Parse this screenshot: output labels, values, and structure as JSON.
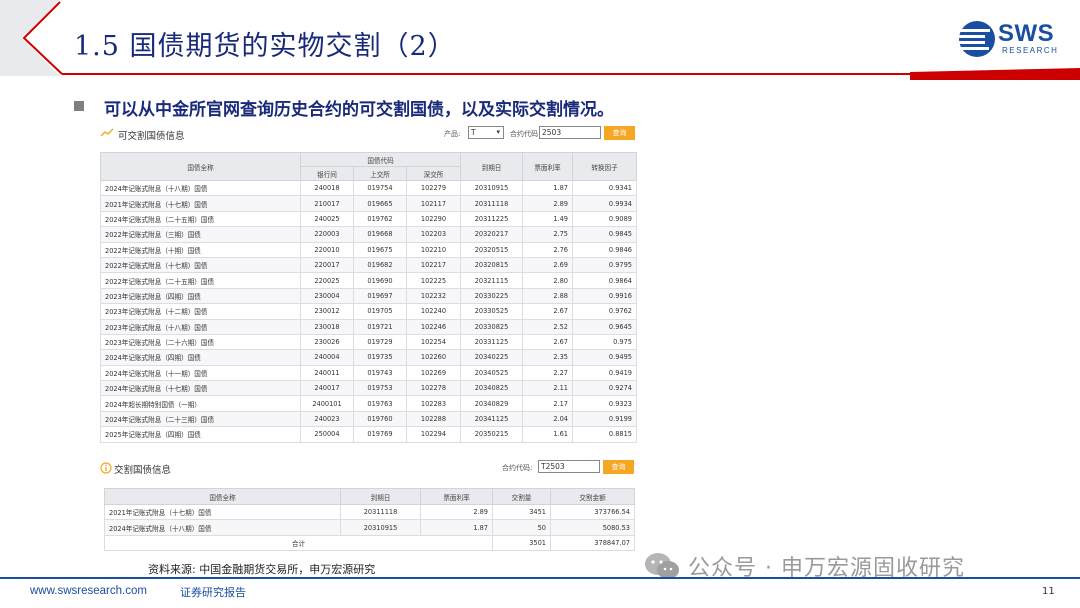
{
  "header": {
    "title": "1.5 国债期货的实物交割（2）",
    "logo_text": "SWS",
    "logo_sub": "RESEARCH",
    "colors": {
      "red": "#cc0000",
      "navy": "#1a2a7a",
      "blue": "#1a4ea0"
    }
  },
  "subtitle": "可以从中金所官网查询历史合约的可交割国债，以及实际交割情况。",
  "deliverable": {
    "title": "可交割国债信息",
    "product_label": "产品:",
    "product_value": "T",
    "contract_label": "合约代码",
    "contract_value": "2503",
    "query_label": "查询",
    "columns": {
      "name": "国债全称",
      "code_group": "国债代码",
      "interbank": "银行间",
      "sse": "上交所",
      "szse": "深交所",
      "maturity": "到期日",
      "coupon": "票面利率",
      "factor": "转换因子"
    },
    "rows": [
      [
        "2024年记账式附息（十八期）国债",
        "240018",
        "019754",
        "102279",
        "20310915",
        "1.87",
        "0.9341"
      ],
      [
        "2021年记账式附息（十七期）国债",
        "210017",
        "019665",
        "102117",
        "20311118",
        "2.89",
        "0.9934"
      ],
      [
        "2024年记账式附息（二十五期）国债",
        "240025",
        "019762",
        "102290",
        "20311225",
        "1.49",
        "0.9089"
      ],
      [
        "2022年记账式附息（三期）国债",
        "220003",
        "019668",
        "102203",
        "20320217",
        "2.75",
        "0.9845"
      ],
      [
        "2022年记账式附息（十期）国债",
        "220010",
        "019675",
        "102210",
        "20320515",
        "2.76",
        "0.9846"
      ],
      [
        "2022年记账式附息（十七期）国债",
        "220017",
        "019682",
        "102217",
        "20320815",
        "2.69",
        "0.9795"
      ],
      [
        "2022年记账式附息（二十五期）国债",
        "220025",
        "019690",
        "102225",
        "20321115",
        "2.80",
        "0.9864"
      ],
      [
        "2023年记账式附息（四期）国债",
        "230004",
        "019697",
        "102232",
        "20330225",
        "2.88",
        "0.9916"
      ],
      [
        "2023年记账式附息（十二期）国债",
        "230012",
        "019705",
        "102240",
        "20330525",
        "2.67",
        "0.9762"
      ],
      [
        "2023年记账式附息（十八期）国债",
        "230018",
        "019721",
        "102246",
        "20330825",
        "2.52",
        "0.9645"
      ],
      [
        "2023年记账式附息（二十六期）国债",
        "230026",
        "019729",
        "102254",
        "20331125",
        "2.67",
        "0.975"
      ],
      [
        "2024年记账式附息（四期）国债",
        "240004",
        "019735",
        "102260",
        "20340225",
        "2.35",
        "0.9495"
      ],
      [
        "2024年记账式附息（十一期）国债",
        "240011",
        "019743",
        "102269",
        "20340525",
        "2.27",
        "0.9419"
      ],
      [
        "2024年记账式附息（十七期）国债",
        "240017",
        "019753",
        "102278",
        "20340825",
        "2.11",
        "0.9274"
      ],
      [
        "2024年超长期特别国债（一期）",
        "2400101",
        "019763",
        "102283",
        "20340829",
        "2.17",
        "0.9323"
      ],
      [
        "2024年记账式附息（二十三期）国债",
        "240023",
        "019760",
        "102288",
        "20341125",
        "2.04",
        "0.9199"
      ],
      [
        "2025年记账式附息（四期）国债",
        "250004",
        "019769",
        "102294",
        "20350215",
        "1.61",
        "0.8815"
      ]
    ]
  },
  "delivery": {
    "title": "交割国债信息",
    "contract_label": "合约代码:",
    "contract_value": "T2503",
    "query_label": "查询",
    "columns": {
      "name": "国债全称",
      "maturity": "到期日",
      "coupon": "票面利率",
      "volume": "交割量",
      "amount": "交割金额"
    },
    "rows": [
      [
        "2021年记账式附息（十七期）国债",
        "20311118",
        "2.89",
        "3451",
        "373766.54"
      ],
      [
        "2024年记账式附息（十八期）国债",
        "20310915",
        "1.87",
        "50",
        "5080.53"
      ]
    ],
    "total": {
      "label": "合计",
      "volume": "3501",
      "amount": "378847.07"
    }
  },
  "source": "资料来源: 中国金融期货交易所，申万宏源研究",
  "footer": {
    "url": "www.swsresearch.com",
    "report": "证券研究报告",
    "page": "11"
  },
  "watermark": "公众号 · 申万宏源固收研究"
}
